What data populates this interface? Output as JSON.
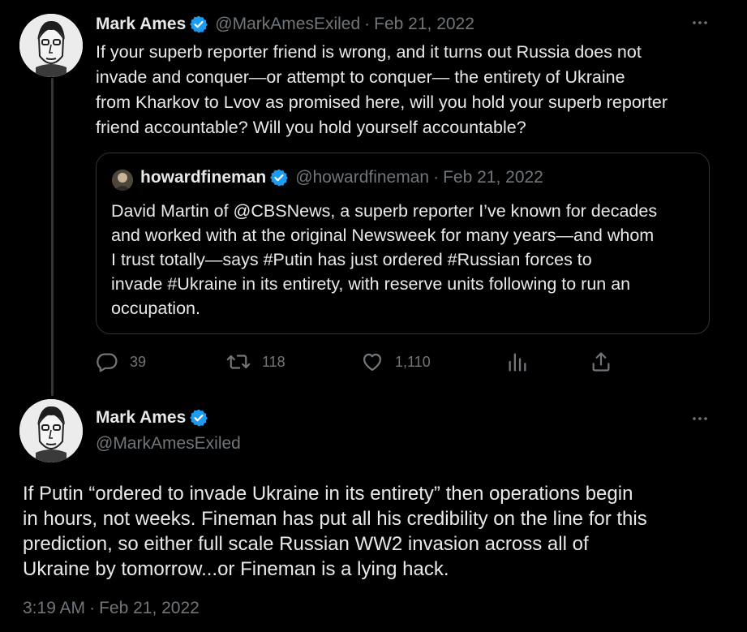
{
  "colors": {
    "background": "#000000",
    "text": "#e7e9ea",
    "muted": "#71767b",
    "border": "#2f3336",
    "verified": "#1d9bf0"
  },
  "reply_tweet": {
    "author_name": "Mark Ames",
    "author_handle": "@MarkAmesExiled",
    "separator": "·",
    "date": "Feb 21, 2022",
    "more_icon": "more-horizontal-icon",
    "text": "If your superb reporter friend is wrong, and it turns out Russia does not\ninvade and conquer—or attempt to conquer— the entirety of Ukraine\nfrom Kharkov to Lvov as promised here, will you hold your superb reporter\nfriend accountable? Will you hold yourself accountable?",
    "quote": {
      "author_name": "howardfineman",
      "author_handle": "@howardfineman",
      "separator": "·",
      "date": "Feb 21, 2022",
      "text": "David Martin of @CBSNews, a superb reporter I’ve known for decades\nand worked with at the original Newsweek for many years—and whom\nI trust totally—says #Putin has just ordered  #Russian forces to\ninvade #Ukraine in its entirety, with reserve units following to run an\noccupation."
    },
    "actions": {
      "replies": "39",
      "retweets": "118",
      "likes": "1,110"
    }
  },
  "main_tweet": {
    "author_name": "Mark Ames",
    "author_handle": "@MarkAmesExiled",
    "more_icon": "more-horizontal-icon",
    "text": "If Putin “ordered to invade Ukraine in its entirety” then operations begin\nin hours, not weeks. Fineman has put all his credibility on the line for this\nprediction, so either full scale Russian WW2 invasion across all of\nUkraine by tomorrow...or Fineman is a lying hack.",
    "time": "3:19 AM",
    "separator": "·",
    "date": "Feb 21, 2022"
  }
}
